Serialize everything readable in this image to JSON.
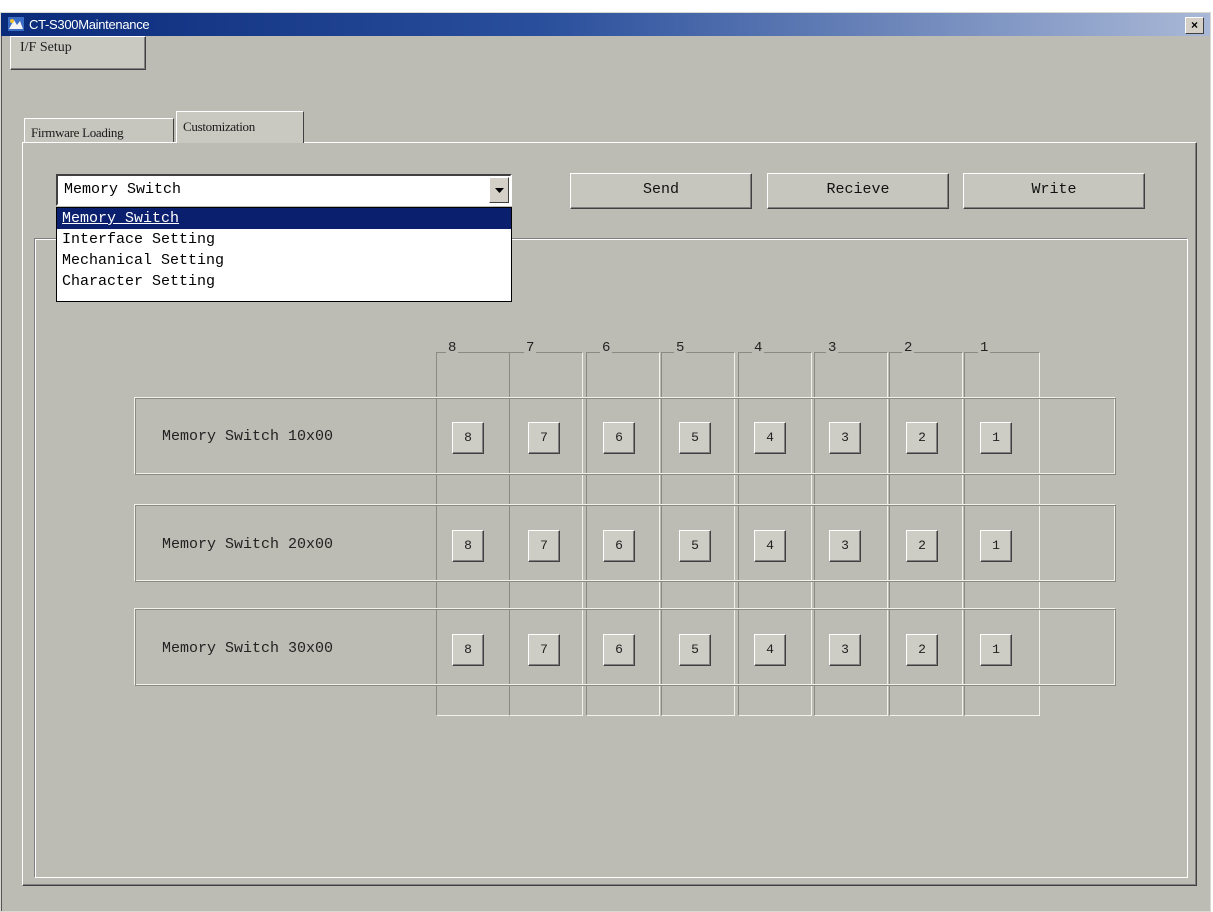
{
  "window": {
    "title": "CT-S300Maintenance",
    "close_glyph": "×"
  },
  "toolbar": {
    "ifsetup_label": "I/F Setup"
  },
  "tabs": [
    {
      "label": "Firmware Loading"
    },
    {
      "label": "Customization"
    }
  ],
  "combo": {
    "selected": "Memory Switch",
    "options": [
      "Memory Switch",
      "Interface Setting",
      "Mechanical Setting",
      "Character Setting"
    ]
  },
  "actions": {
    "send": "Send",
    "receive": "Recieve",
    "write": "Write"
  },
  "bit_headers": [
    "8",
    "7",
    "6",
    "5",
    "4",
    "3",
    "2",
    "1"
  ],
  "rows": [
    {
      "label": "Memory Switch 10x00",
      "bits": [
        "8",
        "7",
        "6",
        "5",
        "4",
        "3",
        "2",
        "1"
      ]
    },
    {
      "label": "Memory Switch 20x00",
      "bits": [
        "8",
        "7",
        "6",
        "5",
        "4",
        "3",
        "2",
        "1"
      ]
    },
    {
      "label": "Memory Switch 30x00",
      "bits": [
        "8",
        "7",
        "6",
        "5",
        "4",
        "3",
        "2",
        "1"
      ]
    }
  ]
}
